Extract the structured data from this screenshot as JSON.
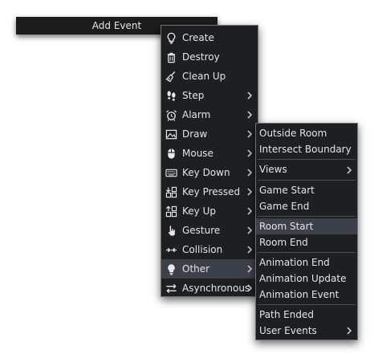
{
  "title_bar": {
    "label": "Add Event"
  },
  "main_menu": {
    "items": [
      {
        "label": "Create",
        "icon": "lightbulb-outline-icon",
        "submenu": false,
        "active": false
      },
      {
        "label": "Destroy",
        "icon": "trash-icon",
        "submenu": false,
        "active": false
      },
      {
        "label": "Clean Up",
        "icon": "broom-icon",
        "submenu": false,
        "active": false
      },
      {
        "label": "Step",
        "icon": "footsteps-icon",
        "submenu": true,
        "active": false
      },
      {
        "label": "Alarm",
        "icon": "alarm-clock-icon",
        "submenu": true,
        "active": false
      },
      {
        "label": "Draw",
        "icon": "picture-icon",
        "submenu": true,
        "active": false
      },
      {
        "label": "Mouse",
        "icon": "mouse-icon",
        "submenu": true,
        "active": false
      },
      {
        "label": "Key Down",
        "icon": "keyboard-icon",
        "submenu": true,
        "active": false
      },
      {
        "label": "Key Pressed",
        "icon": "key-pressed-icon",
        "submenu": true,
        "active": false
      },
      {
        "label": "Key Up",
        "icon": "key-up-icon",
        "submenu": true,
        "active": false
      },
      {
        "label": "Gesture",
        "icon": "pointing-hand-icon",
        "submenu": true,
        "active": false
      },
      {
        "label": "Collision",
        "icon": "collision-arrows-icon",
        "submenu": true,
        "active": false
      },
      {
        "label": "Other",
        "icon": "lightbulb-filled-icon",
        "submenu": true,
        "active": true
      },
      {
        "label": "Asynchronous",
        "icon": "async-arrows-icon",
        "submenu": true,
        "active": false
      }
    ]
  },
  "other_submenu": {
    "groups": [
      [
        {
          "label": "Outside Room",
          "submenu": false
        },
        {
          "label": "Intersect Boundary",
          "submenu": false
        }
      ],
      [
        {
          "label": "Views",
          "submenu": true
        }
      ],
      [
        {
          "label": "Game Start",
          "submenu": false
        },
        {
          "label": "Game End",
          "submenu": false
        }
      ],
      [
        {
          "label": "Room Start",
          "submenu": false,
          "active": true
        },
        {
          "label": "Room End",
          "submenu": false
        }
      ],
      [
        {
          "label": "Animation End",
          "submenu": false
        },
        {
          "label": "Animation Update",
          "submenu": false
        },
        {
          "label": "Animation Event",
          "submenu": false
        }
      ],
      [
        {
          "label": "Path Ended",
          "submenu": false
        },
        {
          "label": "User Events",
          "submenu": true
        }
      ]
    ]
  },
  "colors": {
    "menu_background": "#1e1f21",
    "menu_border": "#6f6f6f",
    "highlight": "#3b4049",
    "text": "#e4e4e4"
  }
}
